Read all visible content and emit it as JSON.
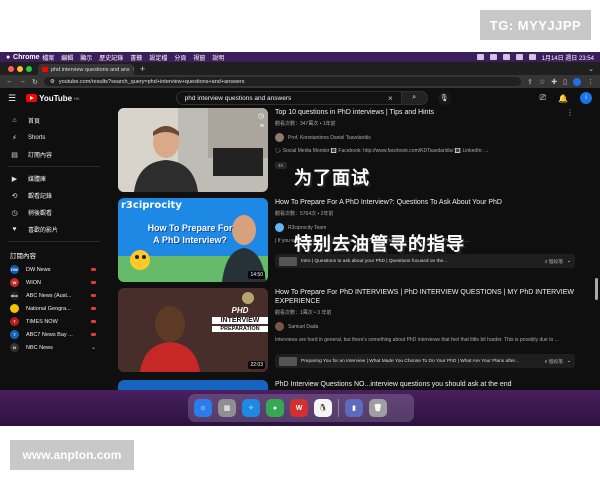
{
  "watermarks": {
    "top": "TG: MYYJJPP",
    "bottom": "www.anpton.com"
  },
  "menubar": {
    "app": "Chrome",
    "items": [
      "檔案",
      "編輯",
      "顯示",
      "歷史記錄",
      "書籤",
      "設定檔",
      "分頁",
      "視窗",
      "說明"
    ],
    "datetime": "1月14日 週日 23:54"
  },
  "browser": {
    "tab_title": "phd interview questions and ans",
    "url": "youtube.com/results?search_query=phd+interview+questions+and+answers"
  },
  "youtube": {
    "logo": "YouTube",
    "logo_region": "HK",
    "search_value": "phd interview questions and answers",
    "user_initial": "i"
  },
  "sidebar": {
    "items": [
      {
        "label": "首頁",
        "icon": "home-icon",
        "glyph": "⌂"
      },
      {
        "label": "Shorts",
        "icon": "shorts-icon",
        "glyph": "⚡"
      },
      {
        "label": "訂閱內容",
        "icon": "subscriptions-icon",
        "glyph": "▤"
      }
    ],
    "items2": [
      {
        "label": "媒體庫",
        "icon": "library-icon",
        "glyph": "▶"
      },
      {
        "label": "觀看記錄",
        "icon": "history-icon",
        "glyph": "⟲"
      },
      {
        "label": "稍後觀看",
        "icon": "watch-later-icon",
        "glyph": "◷"
      },
      {
        "label": "喜歡的影片",
        "icon": "liked-icon",
        "glyph": "♥"
      }
    ],
    "subs_heading": "訂閱內容",
    "subs": [
      {
        "name": "DW News",
        "color": "#0a5cb8",
        "abbr": "DW",
        "indicator": "live"
      },
      {
        "name": "WION",
        "color": "#c62828",
        "abbr": "W",
        "indicator": "live"
      },
      {
        "name": "ABC News (Aust...",
        "color": "#222222",
        "abbr": "abc",
        "indicator": "live"
      },
      {
        "name": "National Geogra...",
        "color": "#f5c400",
        "abbr": "",
        "indicator": "live"
      },
      {
        "name": "TIMES NOW",
        "color": "#b71c1c",
        "abbr": "T",
        "indicator": "live"
      },
      {
        "name": "ABC7 News Bay ...",
        "color": "#1565c0",
        "abbr": "7",
        "indicator": "live"
      },
      {
        "name": "NBC News",
        "color": "#333333",
        "abbr": "N",
        "indicator": "chevron"
      }
    ]
  },
  "results": [
    {
      "title": "Top 10 questions in PhD interviews | Tips and Hints",
      "meta": "觀看次數：347萬次 • 1年前",
      "channel": "Prof. Konstantinos Daniel Tsavdaridis",
      "desc": "🗣 Social Media Monitor 🔳 Facebook: http://www.facebook.com/KDTsavdaridis/ 🔳 LinkedIn: ...",
      "badge": "4K",
      "duration": ""
    },
    {
      "title": "How To Prepare For A PhD Interview?: Questions To Ask About Your PhD",
      "meta": "觀看次數：5764次 • 2年前",
      "channel": "R3ciprocity Team",
      "desc": "| If you want to know how to prepare for a PhD interview ... ...PhD program. The focus ...",
      "duration": "14:50",
      "chapter": "Intro | Questions to ask about your PhD | Questions focused on the...",
      "chapter_count": "3 個段落",
      "thumb_text": "How To Prepare For A PhD Interview?",
      "thumb_brand": "r3ciprocity"
    },
    {
      "title": "How To Prepare For PhD INTERVIEWS | PhD INTERVIEW QUESTIONS | MY PhD INTERVIEW EXPERIENCE",
      "meta": "觀看次數：1萬次 • 3 年前",
      "channel": "Samuel Dada",
      "desc": "Interviews are hard in general, but there's something about PhD interviews that feel that little bit harder. This is possibly due to ...",
      "duration": "22:03",
      "chapter": "Preparing You for an Interview | What Made You Choose To Do Your PhD | What Are Your Plans after...",
      "chapter_count": "6 個段落",
      "thumb_text": [
        "PHD",
        "INTERVIEW",
        "PREPARATION"
      ]
    },
    {
      "title": "PhD Interview Questions NO...interview questions you should ask at the end"
    }
  ],
  "overlay": {
    "line1": "为了面试",
    "line2": "特别去油管寻的指导"
  },
  "dock": {
    "apps": [
      {
        "name": "finder-app",
        "color": "#2b7de9",
        "glyph": "☺"
      },
      {
        "name": "launchpad-app",
        "color": "#8e8e93",
        "glyph": "▦"
      },
      {
        "name": "safari-app",
        "color": "#1e88e5",
        "glyph": "✧"
      },
      {
        "name": "chrome-app",
        "color": "#34a853",
        "glyph": "●"
      },
      {
        "name": "wps-app",
        "color": "#d32f2f",
        "glyph": "W"
      },
      {
        "name": "qq-app",
        "color": "#f5f5f5",
        "glyph": "🐧"
      },
      {
        "name": "downloads-app",
        "color": "#5c6bc0",
        "glyph": "▮"
      },
      {
        "name": "trash-app",
        "color": "#9e9e9e",
        "glyph": "🗑"
      }
    ]
  }
}
